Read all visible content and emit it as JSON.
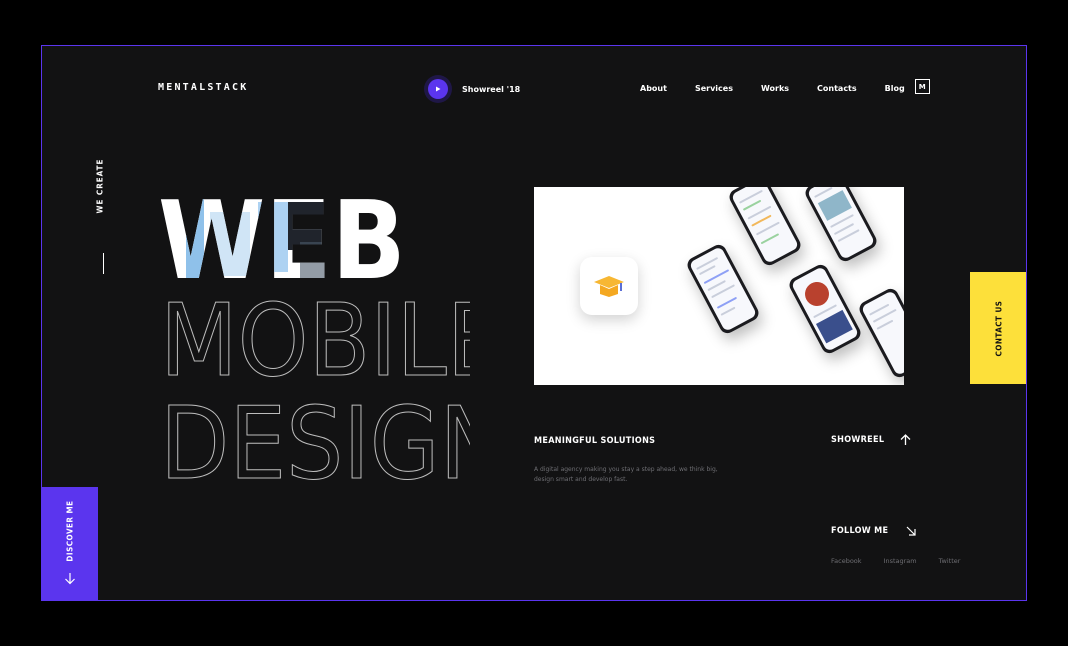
{
  "brand": {
    "logo": "MENTALSTACK"
  },
  "header": {
    "showreel_label": "Showreel '18",
    "nav": [
      {
        "label": "About"
      },
      {
        "label": "Services"
      },
      {
        "label": "Works"
      },
      {
        "label": "Contacts"
      },
      {
        "label": "Blog"
      }
    ],
    "menu_badge": "M"
  },
  "side": {
    "we_create": "WE CREATE"
  },
  "hero": {
    "line1": "WEB",
    "line2": "MOBILE",
    "line3": "DESIGN"
  },
  "contact_tab": {
    "label": "CONTACT US"
  },
  "solutions": {
    "title": "MEANINGFUL SOLUTIONS",
    "description": "A digital agency making you stay a step ahead, we think big, design smart and develop fast."
  },
  "showreel_section": {
    "label": "SHOWREEL"
  },
  "follow": {
    "label": "FOLLOW ME",
    "socials": [
      {
        "label": "Facebook"
      },
      {
        "label": "Instagram"
      },
      {
        "label": "Twitter"
      }
    ]
  },
  "discover": {
    "label": "DISCOVER ME"
  },
  "icons": {
    "play": "play-icon",
    "arrow_up": "arrow-up-icon",
    "arrow_down_right": "arrow-down-right-icon",
    "arrow_down": "arrow-down-icon",
    "graduation_cap": "graduation-cap-icon"
  },
  "colors": {
    "background": "#121213",
    "outer": "#000000",
    "accent_purple": "#5b35ee",
    "accent_yellow": "#fde03a",
    "muted_text": "#6e6e73",
    "text": "#ffffff"
  }
}
